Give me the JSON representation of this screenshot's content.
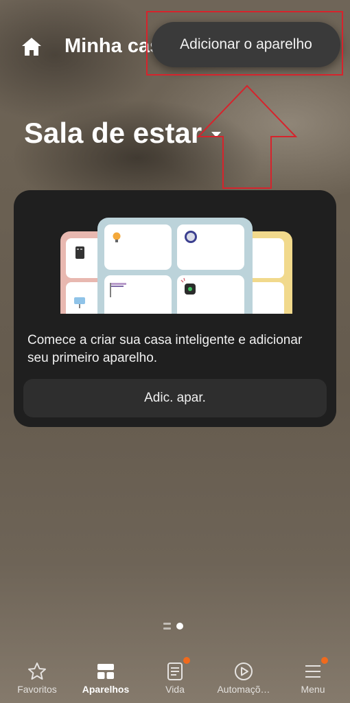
{
  "header": {
    "title": "Minha cas",
    "home_icon": "home-icon"
  },
  "popup_menu": {
    "items": [
      {
        "label": "Adicionar o aparelho"
      }
    ]
  },
  "room": {
    "title": "Sala de estar",
    "dropdown_icon": "caret-down-icon"
  },
  "empty_card": {
    "message": "Comece a criar sua casa inteligente e adicionar seu primeiro aparelho.",
    "button_label": "Adic. apar."
  },
  "pager": {
    "pages": 2,
    "active_page": 2
  },
  "bottom_nav": {
    "items": [
      {
        "label": "Favoritos",
        "icon": "star-icon",
        "active": false,
        "badge": false
      },
      {
        "label": "Aparelhos",
        "icon": "devices-grid-icon",
        "active": true,
        "badge": false
      },
      {
        "label": "Vida",
        "icon": "document-icon",
        "active": false,
        "badge": true
      },
      {
        "label": "Automaçõ…",
        "icon": "play-circle-icon",
        "active": false,
        "badge": false
      },
      {
        "label": "Menu",
        "icon": "menu-icon",
        "active": false,
        "badge": true
      }
    ]
  },
  "colors": {
    "accent_badge": "#f06a1d",
    "annotation_red": "#d7232c",
    "card_bg": "#1f1f1f"
  }
}
